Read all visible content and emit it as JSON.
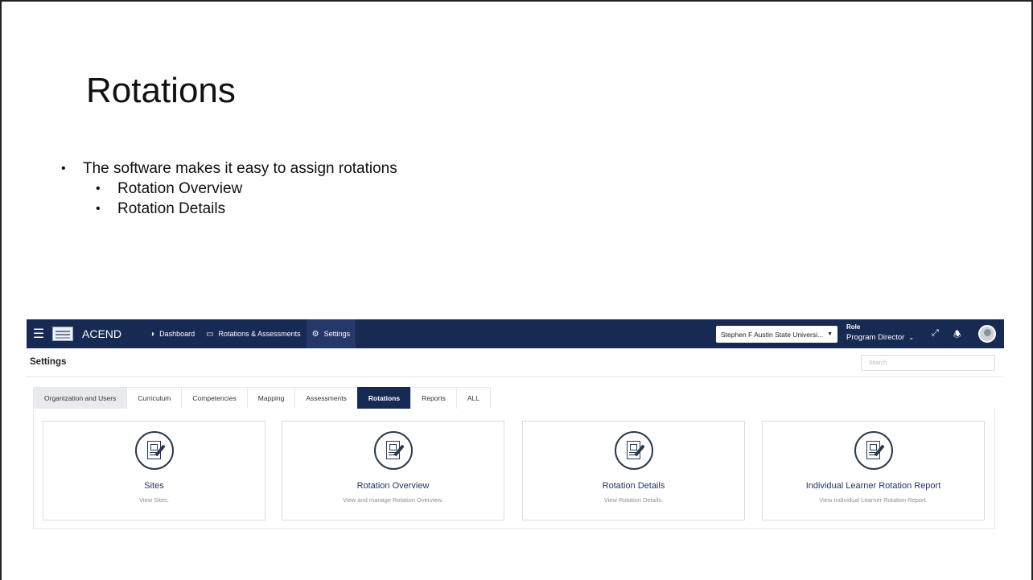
{
  "slide": {
    "title": "Rotations",
    "bullets": {
      "main": "The software makes it easy to assign rotations",
      "sub": [
        "Rotation Overview",
        "Rotation Details"
      ]
    }
  },
  "app": {
    "brand": "ACEND",
    "nav": [
      {
        "label": "Dashboard",
        "icon": "dashboard-icon"
      },
      {
        "label": "Rotations & Assessments",
        "icon": "monitor-icon"
      },
      {
        "label": "Settings",
        "icon": "gear-icon",
        "active": true
      }
    ],
    "org_select": "Stephen F Austin State Universi...",
    "role": {
      "label": "Role",
      "value": "Program Director"
    },
    "page_heading": "Settings",
    "search_placeholder": "Search",
    "tabs": [
      "Organization and Users",
      "Curriculum",
      "Competencies",
      "Mapping",
      "Assessments",
      "Rotations",
      "Reports",
      "ALL"
    ],
    "active_tab": "Rotations",
    "cards": [
      {
        "title": "Sites",
        "desc": "View Sites."
      },
      {
        "title": "Rotation Overview",
        "desc": "View and manage Rotation Overview."
      },
      {
        "title": "Rotation Details",
        "desc": "View Rotation Details."
      },
      {
        "title": "Individual Learner Rotation Report",
        "desc": "View Individual Learner Rotation Report."
      }
    ],
    "colors": {
      "navbar": "#172a53",
      "active_tab": "#172a53",
      "card_title": "#23355f"
    }
  }
}
